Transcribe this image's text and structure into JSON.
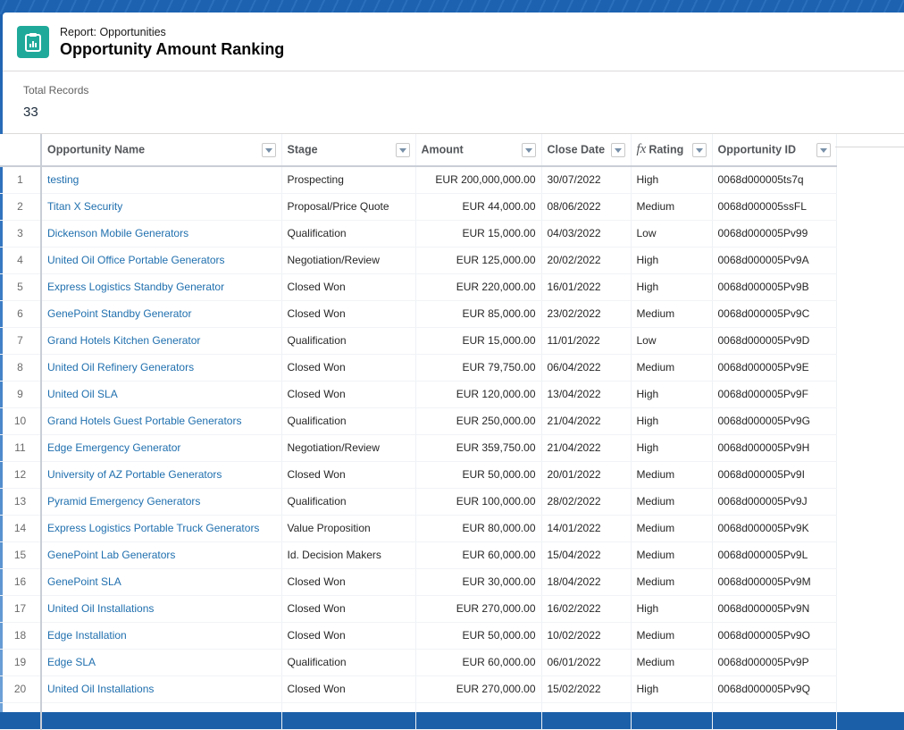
{
  "header": {
    "subtitle": "Report: Opportunities",
    "title": "Opportunity Amount Ranking",
    "icon": "report-icon",
    "icon_color": "#1fa99a"
  },
  "summary": {
    "label": "Total Records",
    "value": "33"
  },
  "table": {
    "columns": [
      {
        "label": "Opportunity Name",
        "formula": false
      },
      {
        "label": "Stage",
        "formula": false
      },
      {
        "label": "Amount",
        "formula": false
      },
      {
        "label": "Close Date",
        "formula": false
      },
      {
        "label": "Rating",
        "formula": true,
        "formula_icon": "fx"
      },
      {
        "label": "Opportunity ID",
        "formula": false
      }
    ],
    "rows": [
      {
        "num": "1",
        "name": "testing",
        "stage": "Prospecting",
        "amount": "EUR 200,000,000.00",
        "close_date": "30/07/2022",
        "rating": "High",
        "id": "0068d000005ts7q"
      },
      {
        "num": "2",
        "name": "Titan X Security",
        "stage": "Proposal/Price Quote",
        "amount": "EUR 44,000.00",
        "close_date": "08/06/2022",
        "rating": "Medium",
        "id": "0068d000005ssFL"
      },
      {
        "num": "3",
        "name": "Dickenson Mobile Generators",
        "stage": "Qualification",
        "amount": "EUR 15,000.00",
        "close_date": "04/03/2022",
        "rating": "Low",
        "id": "0068d000005Pv99"
      },
      {
        "num": "4",
        "name": "United Oil Office Portable Generators",
        "stage": "Negotiation/Review",
        "amount": "EUR 125,000.00",
        "close_date": "20/02/2022",
        "rating": "High",
        "id": "0068d000005Pv9A"
      },
      {
        "num": "5",
        "name": "Express Logistics Standby Generator",
        "stage": "Closed Won",
        "amount": "EUR 220,000.00",
        "close_date": "16/01/2022",
        "rating": "High",
        "id": "0068d000005Pv9B"
      },
      {
        "num": "6",
        "name": "GenePoint Standby Generator",
        "stage": "Closed Won",
        "amount": "EUR 85,000.00",
        "close_date": "23/02/2022",
        "rating": "Medium",
        "id": "0068d000005Pv9C"
      },
      {
        "num": "7",
        "name": "Grand Hotels Kitchen Generator",
        "stage": "Qualification",
        "amount": "EUR 15,000.00",
        "close_date": "11/01/2022",
        "rating": "Low",
        "id": "0068d000005Pv9D"
      },
      {
        "num": "8",
        "name": "United Oil Refinery Generators",
        "stage": "Closed Won",
        "amount": "EUR 79,750.00",
        "close_date": "06/04/2022",
        "rating": "Medium",
        "id": "0068d000005Pv9E"
      },
      {
        "num": "9",
        "name": "United Oil SLA",
        "stage": "Closed Won",
        "amount": "EUR 120,000.00",
        "close_date": "13/04/2022",
        "rating": "High",
        "id": "0068d000005Pv9F"
      },
      {
        "num": "10",
        "name": "Grand Hotels Guest Portable Generators",
        "stage": "Qualification",
        "amount": "EUR 250,000.00",
        "close_date": "21/04/2022",
        "rating": "High",
        "id": "0068d000005Pv9G"
      },
      {
        "num": "11",
        "name": "Edge Emergency Generator",
        "stage": "Negotiation/Review",
        "amount": "EUR 359,750.00",
        "close_date": "21/04/2022",
        "rating": "High",
        "id": "0068d000005Pv9H"
      },
      {
        "num": "12",
        "name": "University of AZ Portable Generators",
        "stage": "Closed Won",
        "amount": "EUR 50,000.00",
        "close_date": "20/01/2022",
        "rating": "Medium",
        "id": "0068d000005Pv9I"
      },
      {
        "num": "13",
        "name": "Pyramid Emergency Generators",
        "stage": "Qualification",
        "amount": "EUR 100,000.00",
        "close_date": "28/02/2022",
        "rating": "Medium",
        "id": "0068d000005Pv9J"
      },
      {
        "num": "14",
        "name": "Express Logistics Portable Truck Generators",
        "stage": "Value Proposition",
        "amount": "EUR 80,000.00",
        "close_date": "14/01/2022",
        "rating": "Medium",
        "id": "0068d000005Pv9K"
      },
      {
        "num": "15",
        "name": "GenePoint Lab Generators",
        "stage": "Id. Decision Makers",
        "amount": "EUR 60,000.00",
        "close_date": "15/04/2022",
        "rating": "Medium",
        "id": "0068d000005Pv9L"
      },
      {
        "num": "16",
        "name": "GenePoint SLA",
        "stage": "Closed Won",
        "amount": "EUR 30,000.00",
        "close_date": "18/04/2022",
        "rating": "Medium",
        "id": "0068d000005Pv9M"
      },
      {
        "num": "17",
        "name": "United Oil Installations",
        "stage": "Closed Won",
        "amount": "EUR 270,000.00",
        "close_date": "16/02/2022",
        "rating": "High",
        "id": "0068d000005Pv9N"
      },
      {
        "num": "18",
        "name": "Edge Installation",
        "stage": "Closed Won",
        "amount": "EUR 50,000.00",
        "close_date": "10/02/2022",
        "rating": "Medium",
        "id": "0068d000005Pv9O"
      },
      {
        "num": "19",
        "name": "Edge SLA",
        "stage": "Qualification",
        "amount": "EUR 60,000.00",
        "close_date": "06/01/2022",
        "rating": "Medium",
        "id": "0068d000005Pv9P"
      },
      {
        "num": "20",
        "name": "United Oil Installations",
        "stage": "Closed Won",
        "amount": "EUR 270,000.00",
        "close_date": "15/02/2022",
        "rating": "High",
        "id": "0068d000005Pv9Q"
      }
    ]
  },
  "colors": {
    "link": "#1f6fae",
    "brand_background": "#1b5fa8"
  }
}
